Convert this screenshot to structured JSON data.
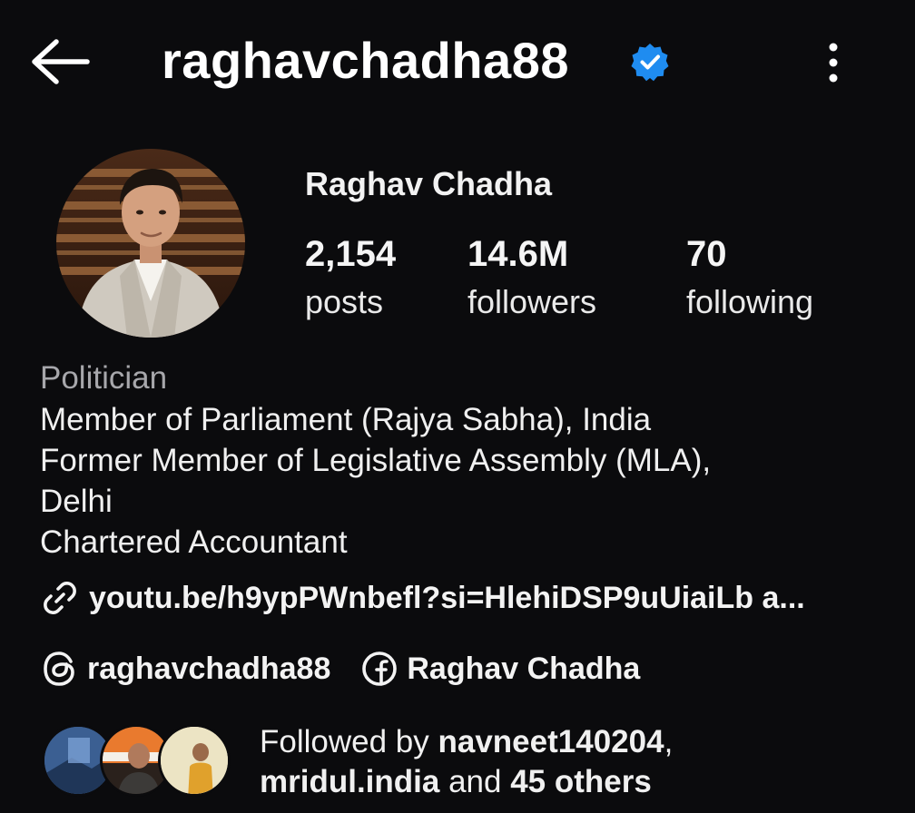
{
  "header": {
    "username": "raghavchadha88",
    "verified": true,
    "back_icon": "arrow-left-icon",
    "more_icon": "vertical-dots-icon"
  },
  "profile": {
    "display_name": "Raghav Chadha",
    "stats": [
      {
        "value": "2,154",
        "label": "posts"
      },
      {
        "value": "14.6M",
        "label": "followers"
      },
      {
        "value": "70",
        "label": "following"
      }
    ]
  },
  "bio": {
    "category": "Politician",
    "lines": [
      "Member of Parliament (Rajya Sabha), India",
      "Former Member of Legislative Assembly (MLA),",
      "Delhi",
      "Chartered Accountant"
    ],
    "link": "youtu.be/h9ypPWnbefl?si=HlehiDSP9uUiaiLb a..."
  },
  "social": {
    "threads_handle": "raghavchadha88",
    "facebook_name": "Raghav Chadha"
  },
  "followed_by": {
    "prefix": "Followed by ",
    "user1": "navneet140204",
    "sep": ",",
    "user2": "mridul.india",
    "mid": " and ",
    "others": "45 others"
  },
  "colors": {
    "background": "#0b0b0d",
    "verified_blue": "#1f8cf0",
    "secondary_text": "#a7a7ab"
  }
}
